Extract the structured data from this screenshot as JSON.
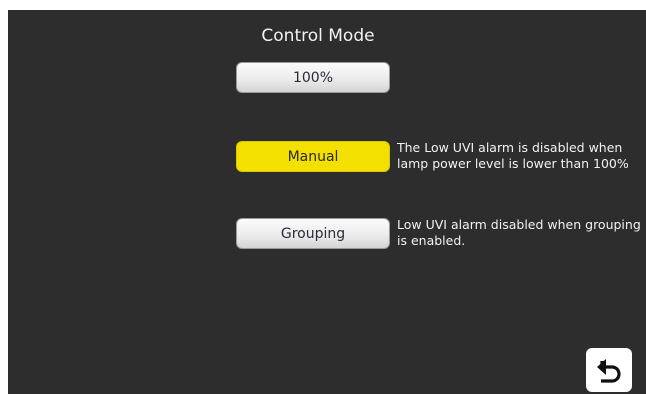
{
  "title": "Control Mode",
  "buttons": {
    "power": "100%",
    "manual": "Manual",
    "grouping": "Grouping"
  },
  "notes": {
    "manual": "The Low UVI alarm is disabled when lamp power level is lower than 100%",
    "grouping": "Low UVI alarm disabled when grouping is enabled."
  },
  "icons": {
    "back": "back-arrow-icon"
  },
  "colors": {
    "background": "#2d2d2d",
    "active_button": "#f3df00",
    "inactive_button": "#ececec"
  }
}
